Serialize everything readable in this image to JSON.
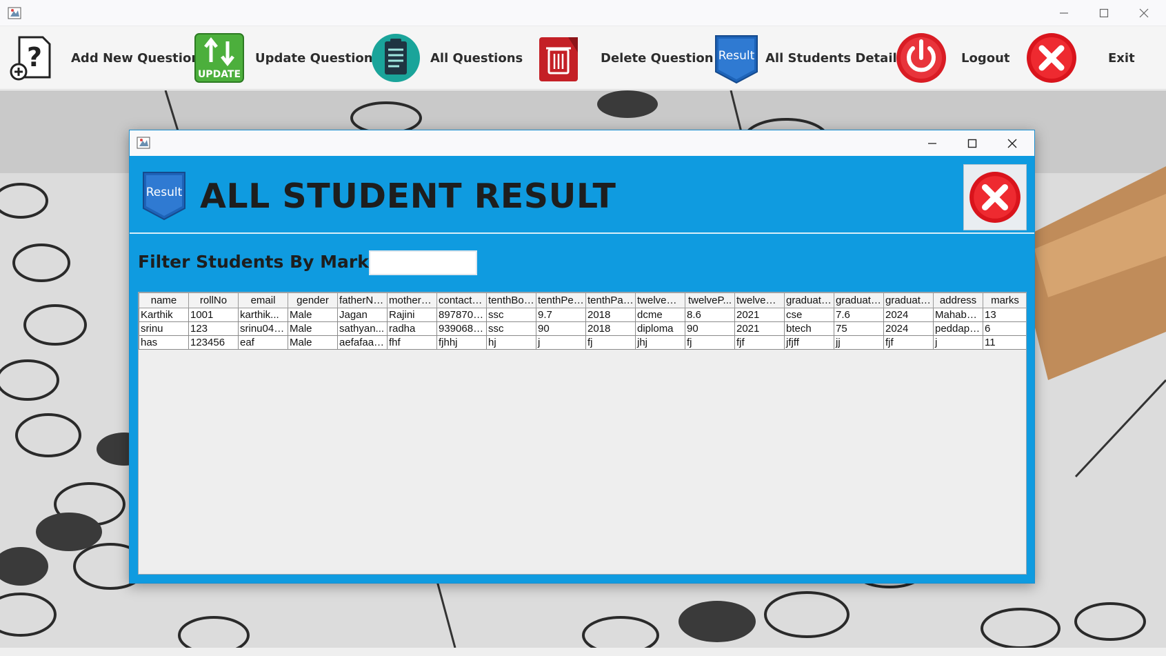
{
  "toolbar": {
    "items": [
      {
        "label": "Add New Question",
        "icon": "add-question-icon"
      },
      {
        "label": "Update Question",
        "icon": "update-icon"
      },
      {
        "label": "All Questions",
        "icon": "questions-list-icon"
      },
      {
        "label": "Delete Question",
        "icon": "trash-icon"
      },
      {
        "label": "All Students Details",
        "icon": "result-badge-icon"
      },
      {
        "label": "Logout",
        "icon": "power-icon"
      },
      {
        "label": "Exit",
        "icon": "close-icon"
      }
    ],
    "update_icon_text": "UPDATE",
    "result_icon_text": "Result"
  },
  "dialog": {
    "title": "ALL STUDENT RESULT",
    "badge_text": "Result",
    "filter_label": "Filter Students By Marks",
    "filter_value": "",
    "accent_color": "#0f9be0"
  },
  "table": {
    "columns": [
      "name",
      "rollNo",
      "email",
      "gender",
      "fatherNa...",
      "motherN...",
      "contactNo",
      "tenthBoa...",
      "tenthPer...",
      "tenthPas...",
      "twelveGr...",
      "twelveP...",
      "twelvePa...",
      "graduatio...",
      "graduatio...",
      "graduatio...",
      "address",
      "marks"
    ],
    "rows": [
      [
        "Karthik",
        "1001",
        "karthik...",
        "Male",
        "Jagan",
        "Rajini",
        "8978703...",
        "ssc",
        "9.7",
        "2018",
        "dcme",
        "8.6",
        "2021",
        "cse",
        "7.6",
        "2024",
        "Mahabub...",
        "13"
      ],
      [
        "srinu",
        "123",
        "srinu046...",
        "Male",
        "sathyan...",
        "radha",
        "9390689...",
        "ssc",
        "90",
        "2018",
        "diploma",
        "90",
        "2021",
        "btech",
        "75",
        "2024",
        "peddapalli",
        "6"
      ],
      [
        "has",
        "123456",
        "eaf",
        "Male",
        "aefafaafaff",
        "fhf",
        "fjhhj",
        "hj",
        "j",
        "fj",
        "jhj",
        "fj",
        "fjf",
        "jfjff",
        "jj",
        "fjf",
        "j",
        "11"
      ]
    ]
  }
}
